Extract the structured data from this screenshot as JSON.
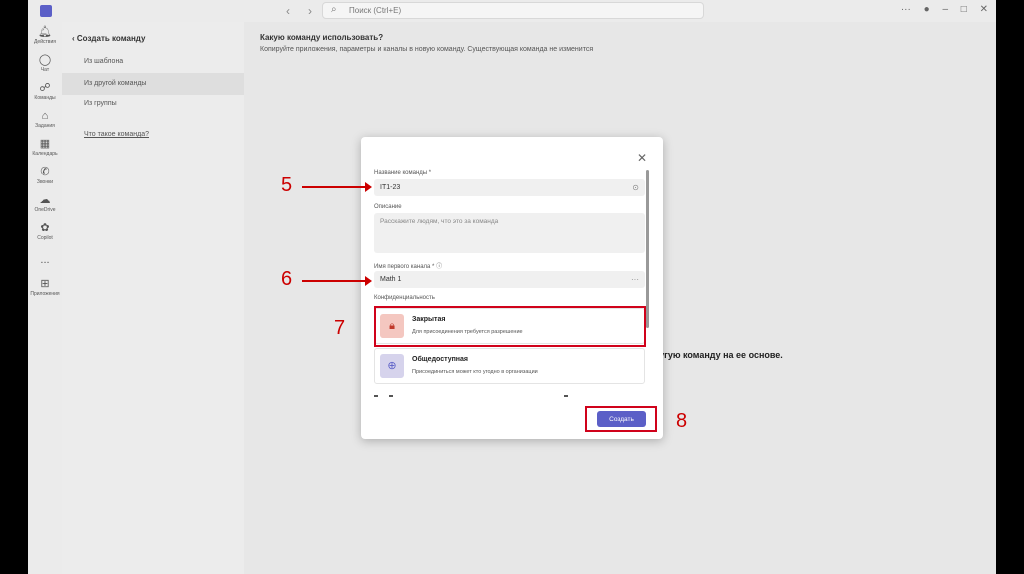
{
  "titlebar": {
    "search_placeholder": "Поиск (Ctrl+E)"
  },
  "rail": [
    {
      "icon": "bell-icon",
      "label": "Действия"
    },
    {
      "icon": "chat-icon",
      "label": "Чат"
    },
    {
      "icon": "teams-icon",
      "label": "Команды"
    },
    {
      "icon": "assignments-icon",
      "label": "Задания"
    },
    {
      "icon": "calendar-icon",
      "label": "Календарь"
    },
    {
      "icon": "calls-icon",
      "label": "Звонки"
    },
    {
      "icon": "onedrive-icon",
      "label": "OneDrive"
    },
    {
      "icon": "copilot-icon",
      "label": "Copilot"
    },
    {
      "icon": "more-icon",
      "label": "..."
    },
    {
      "icon": "apps-icon",
      "label": "Приложения"
    }
  ],
  "sidepanel": {
    "back_title": "Создать команду",
    "items": [
      "Из шаблона",
      "Из другой команды",
      "Из группы"
    ],
    "link": "Что такое команда?"
  },
  "main": {
    "title": "Какую команду использовать?",
    "subtitle": "Копируйте приложения, параметры и каналы в новую команду. Существующая команда не изменится",
    "hint": "другую команду на ее основе."
  },
  "modal": {
    "team_name_label": "Название команды *",
    "team_name_value": "IT1-23",
    "description_label": "Описание",
    "description_placeholder": "Расскажите людям, что это за команда",
    "channel_label": "Имя первого канала *",
    "channel_value": "Math 1",
    "privacy_label": "Конфиденциальность",
    "options": [
      {
        "title": "Закрытая",
        "desc": "Для присоединения требуется разрешение"
      },
      {
        "title": "Общедоступная",
        "desc": "Присоединиться может кто угодно в организации"
      }
    ],
    "create_label": "Создать"
  },
  "annotations": [
    "5",
    "6",
    "7",
    "8"
  ],
  "colors": {
    "accent": "#5b5fc7",
    "annotation": "#cc0000",
    "private_icon_bg": "#f4c7c0",
    "public_icon_bg": "#d6d3ec"
  }
}
